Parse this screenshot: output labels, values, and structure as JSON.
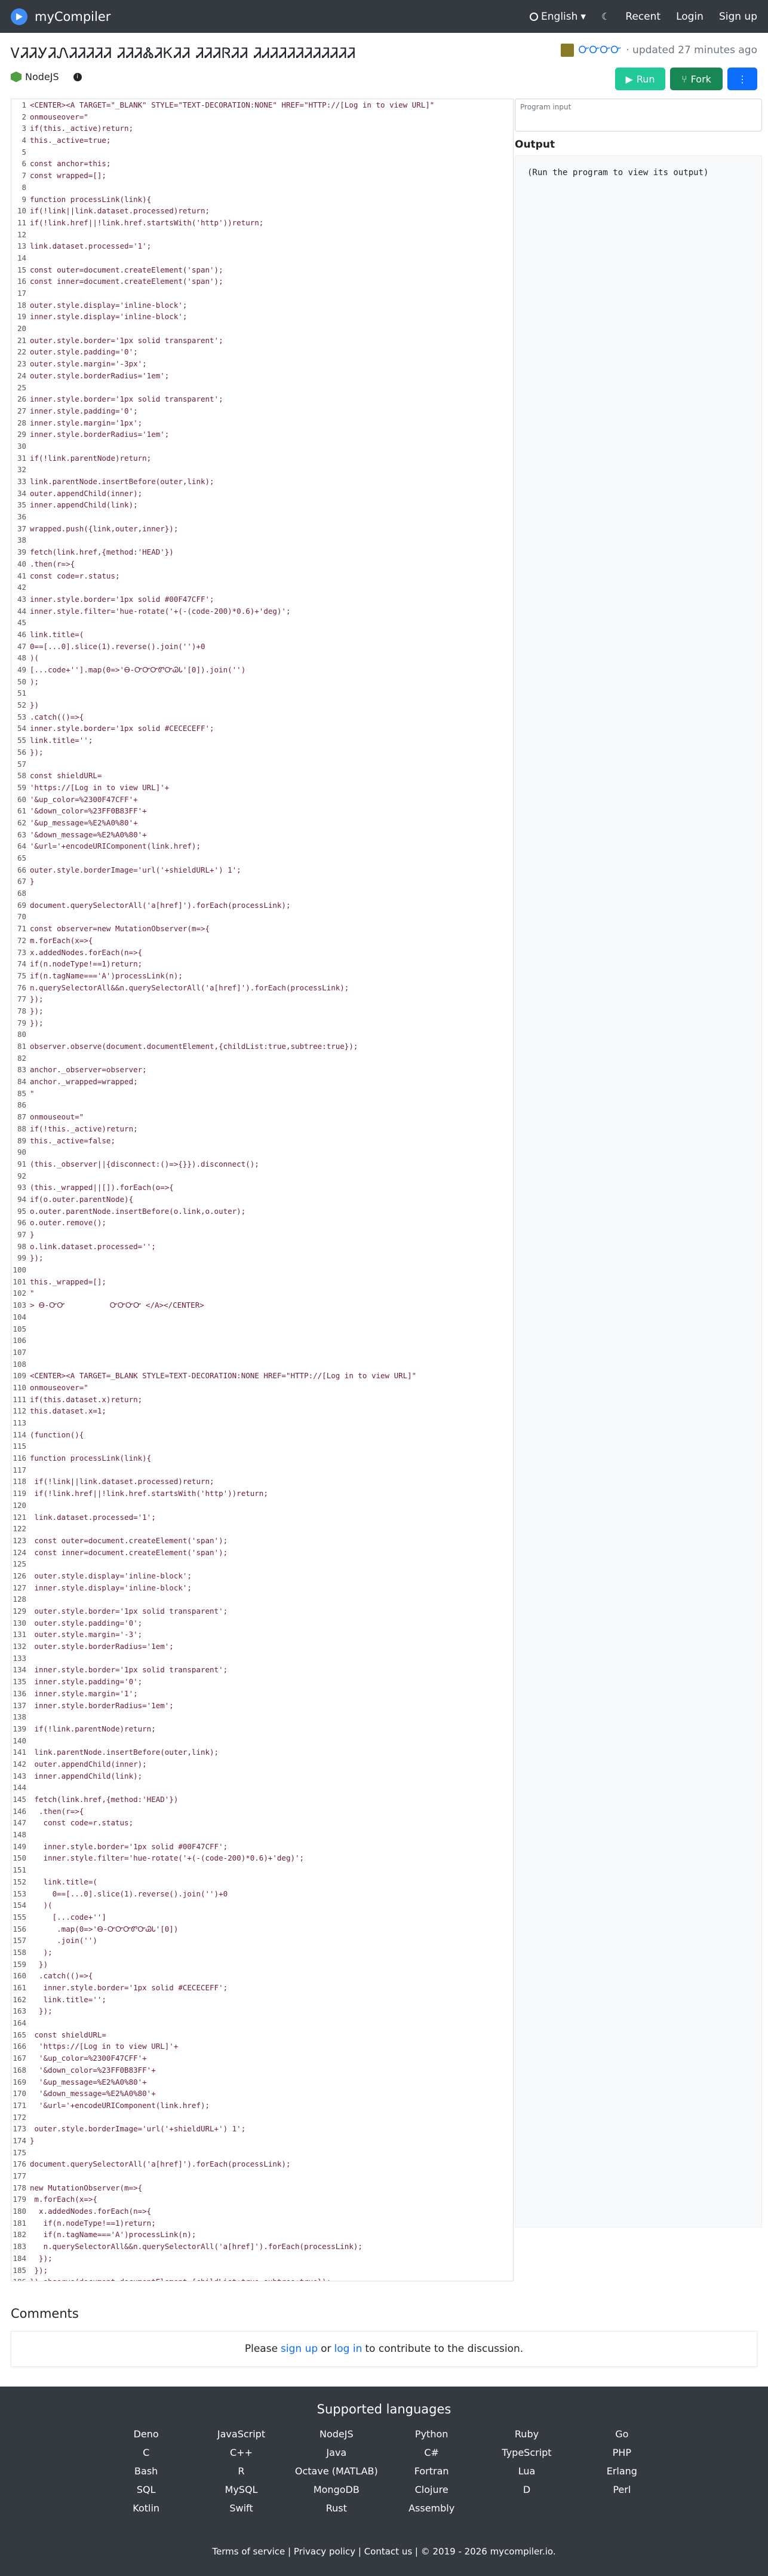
{
  "nav": {
    "brand": "myCompiler",
    "language": "English",
    "recent": "Recent",
    "login": "Login",
    "signup": "Sign up"
  },
  "page": {
    "title": "ᏙᏘᏘᎩᏘᏁᏘᏘᏘᏘᏘ ᏘᏘᏘᏜᏘᏦᏘᏘ ᏘᏘᏘᏒᏘᏘ ᏘᏗᏘᏘᏘᏘᏘᏘᏘᏘᏘᏘ",
    "author": "ᏅᏅᏅᏅ",
    "updated": "· updated 27 minutes ago",
    "lang": "NodeJS"
  },
  "buttons": {
    "run": "Run",
    "fork": "Fork"
  },
  "input": {
    "placeholder": "Program input"
  },
  "output": {
    "label": "Output",
    "text": "(Run the program to view its output)"
  },
  "code": [
    "<CENTER><A TARGET=\"_BLANK\" STYLE=\"TEXT-DECORATION:NONE\" HREF=\"HTTP://[Log in to view URL]\"",
    "onmouseover=\"",
    "if(this._active)return;",
    "this._active=true;",
    "",
    "const anchor=this;",
    "const wrapped=[];",
    "",
    "function processLink(link){",
    "if(!link||link.dataset.processed)return;",
    "if(!link.href||!link.href.startsWith('http'))return;",
    "",
    "link.dataset.processed='1';",
    "",
    "const outer=document.createElement('span');",
    "const inner=document.createElement('span');",
    "",
    "outer.style.display='inline-block';",
    "inner.style.display='inline-block';",
    "",
    "outer.style.border='1px solid transparent';",
    "outer.style.padding='0';",
    "outer.style.margin='-3px';",
    "outer.style.borderRadius='1em';",
    "",
    "inner.style.border='1px solid transparent';",
    "inner.style.padding='0';",
    "inner.style.margin='1px';",
    "inner.style.borderRadius='1em';",
    "",
    "if(!link.parentNode)return;",
    "",
    "link.parentNode.insertBefore(outer,link);",
    "outer.appendChild(inner);",
    "inner.appendChild(link);",
    "",
    "wrapped.push({link,outer,inner});",
    "",
    "fetch(link.href,{method:'HEAD'})",
    ".then(r=>{",
    "const code=r.status;",
    "",
    "inner.style.border='1px solid #00F47CFF';",
    "inner.style.filter='hue-rotate('+(-(code-200)*0.6)+'deg)';",
    "",
    "link.title=(",
    "0==[...0].slice(1).reverse().join('')+0",
    ")(",
    "[...code+''].map(0=>'Ꮎ-ᏅᏅᏅᏛᏅᏊᏓ'[0]).join('')",
    ");",
    "",
    "})",
    ".catch(()=>{",
    "inner.style.border='1px solid #CECECEFF';",
    "link.title='';",
    "});",
    "",
    "const shieldURL=",
    "'https://[Log in to view URL]'+",
    "'&up_color=%2300F47CFF'+",
    "'&down_color=%23FF0B83FF'+",
    "'&up_message=%E2%A0%80'+",
    "'&down_message=%E2%A0%80'+",
    "'&url='+encodeURIComponent(link.href);",
    "",
    "outer.style.borderImage='url('+shieldURL+') 1';",
    "}",
    "",
    "document.querySelectorAll('a[href]').forEach(processLink);",
    "",
    "const observer=new MutationObserver(m=>{",
    "m.forEach(x=>{",
    "x.addedNodes.forEach(n=>{",
    "if(n.nodeType!==1)return;",
    "if(n.tagName==='A')processLink(n);",
    "n.querySelectorAll&&n.querySelectorAll('a[href]').forEach(processLink);",
    "});",
    "});",
    "});",
    "",
    "observer.observe(document.documentElement,{childList:true,subtree:true});",
    "",
    "anchor._observer=observer;",
    "anchor._wrapped=wrapped;",
    "\"",
    "",
    "onmouseout=\"",
    "if(!this._active)return;",
    "this._active=false;",
    "",
    "(this._observer||{disconnect:()=>{}}).disconnect();",
    "",
    "(this._wrapped||[]).forEach(o=>{",
    "if(o.outer.parentNode){",
    "o.outer.parentNode.insertBefore(o.link,o.outer);",
    "o.outer.remove();",
    "}",
    "o.link.dataset.processed='';",
    "});",
    "",
    "this._wrapped=[];",
    "\"",
    "> Ꮎ-ᏅᏅ          ᏅᏅᏅᏅ </A></CENTER>",
    "",
    "",
    "",
    "",
    "",
    "<CENTER><A TARGET=_BLANK STYLE=TEXT-DECORATION:NONE HREF=\"HTTP://[Log in to view URL]\"",
    "onmouseover=\"",
    "if(this.dataset.x)return;",
    "this.dataset.x=1;",
    "",
    "(function(){",
    "",
    "function processLink(link){",
    "",
    " if(!link||link.dataset.processed)return;",
    " if(!link.href||!link.href.startsWith('http'))return;",
    "",
    " link.dataset.processed='1';",
    "",
    " const outer=document.createElement('span');",
    " const inner=document.createElement('span');",
    "",
    " outer.style.display='inline-block';",
    " inner.style.display='inline-block';",
    "",
    " outer.style.border='1px solid transparent';",
    " outer.style.padding='0';",
    " outer.style.margin='-3';",
    " outer.style.borderRadius='1em';",
    "",
    " inner.style.border='1px solid transparent';",
    " inner.style.padding='0';",
    " inner.style.margin='1';",
    " inner.style.borderRadius='1em';",
    "",
    " if(!link.parentNode)return;",
    "",
    " link.parentNode.insertBefore(outer,link);",
    " outer.appendChild(inner);",
    " inner.appendChild(link);",
    "",
    " fetch(link.href,{method:'HEAD'})",
    "  .then(r=>{",
    "   const code=r.status;",
    "",
    "   inner.style.border='1px solid #00F47CFF';",
    "   inner.style.filter='hue-rotate('+(-(code-200)*0.6)+'deg)';",
    "",
    "   link.title=(",
    "     0==[...0].slice(1).reverse().join('')+0",
    "   )(",
    "     [...code+'']",
    "      .map(0=>'Ꮎ-ᏅᏅᏅᏛᏅᏊᏓ'[0])",
    "      .join('')",
    "   );",
    "  })",
    "  .catch(()=>{",
    "   inner.style.border='1px solid #CECECEFF';",
    "   link.title='';",
    "  });",
    "",
    " const shieldURL=",
    "  'https://[Log in to view URL]'+",
    "  '&up_color=%2300F47CFF'+",
    "  '&down_color=%23FF0B83FF'+",
    "  '&up_message=%E2%A0%80'+",
    "  '&down_message=%E2%A0%80'+",
    "  '&url='+encodeURIComponent(link.href);",
    "",
    " outer.style.borderImage='url('+shieldURL+') 1';",
    "}",
    "",
    "document.querySelectorAll('a[href]').forEach(processLink);",
    "",
    "new MutationObserver(m=>{",
    " m.forEach(x=>{",
    "  x.addedNodes.forEach(n=>{",
    "   if(n.nodeType!==1)return;",
    "   if(n.tagName==='A')processLink(n);",
    "   n.querySelectorAll&&n.querySelectorAll('a[href]').forEach(processLink);",
    "  });",
    " });",
    "}).observe(document.documentElement,{childList:true,subtree:true});",
    "",
    "})();"
  ],
  "comments": {
    "title": "Comments",
    "text_pre": "Please",
    "signup": "sign up",
    "or": "or",
    "login": "log in",
    "text_post": "to contribute to the discussion."
  },
  "footer": {
    "title": "Supported languages",
    "languages": [
      "Deno",
      "JavaScript",
      "NodeJS",
      "Python",
      "Ruby",
      "Go",
      "C",
      "C++",
      "Java",
      "C#",
      "TypeScript",
      "PHP",
      "Bash",
      "R",
      "Octave (MATLAB)",
      "Fortran",
      "Lua",
      "Erlang",
      "SQL",
      "MySQL",
      "MongoDB",
      "Clojure",
      "D",
      "Perl",
      "Kotlin",
      "Swift",
      "Rust",
      "Assembly"
    ],
    "links": "Terms of service | Privacy policy | Contact us | © 2019 - 2026 mycompiler.io."
  }
}
